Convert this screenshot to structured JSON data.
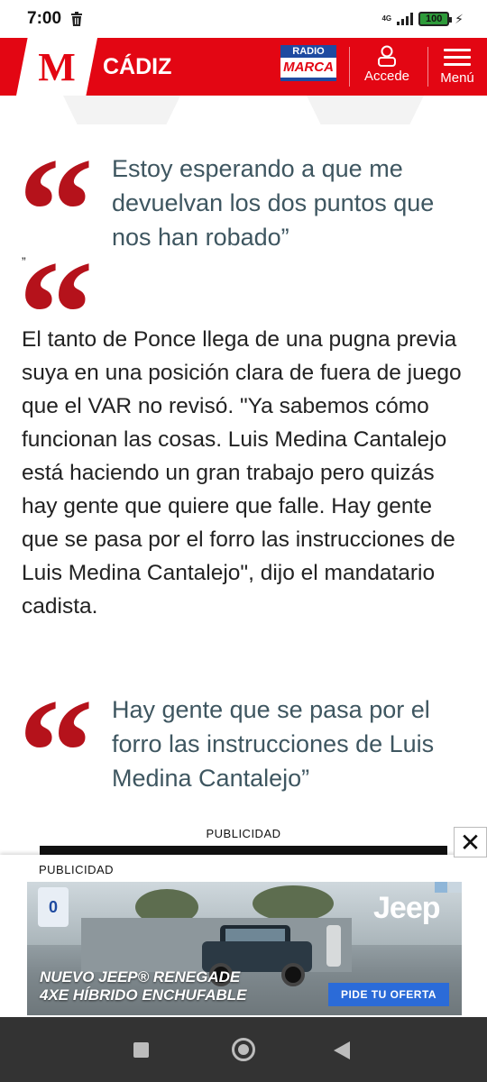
{
  "status_bar": {
    "time": "7:00",
    "network": "4G",
    "battery": "100"
  },
  "header": {
    "logo_letter": "M",
    "section": "CÁDIZ",
    "radio_top": "RADIO",
    "radio_bottom": "MARCA",
    "login_label": "Accede",
    "menu_label": "Menú",
    "brand_color": "#e30613"
  },
  "article": {
    "quote1": "Estoy esperando a que me devuelvan los dos puntos que nos han robado”",
    "stray_mark": "”",
    "paragraph": "El tanto de Ponce llega de una pugna previa suya en una posición clara de fuera de juego que el VAR no revisó. \"Ya sabemos cómo funcionan las cosas. Luis Medina Cantalejo está haciendo un gran trabajo pero quizás hay gente que quiere que falle. Hay gente que se pasa por el forro las instrucciones de Luis Medina Cantalejo\", dijo el mandatario cadista.",
    "quote2": "Hay gente que se pasa por el forro las instrucciones de Luis Medina Cantalejo”",
    "quote_glyph": "“"
  },
  "ads": {
    "inline_label": "PUBLICIDAD",
    "bottom_label": "PUBLICIDAD",
    "close_glyph": "✕",
    "brand": "Jeep",
    "headline_line1": "NUEVO JEEP® RENEGADE",
    "headline_line2": "4XE HÍBRIDO ENCHUFABLE",
    "cta": "PIDE TU OFERTA",
    "badge": "0"
  },
  "icons": [
    "trash-icon",
    "signal-icon",
    "battery-icon",
    "charging-bolt-icon",
    "user-icon",
    "hamburger-menu-icon",
    "close-icon",
    "nav-recents-icon",
    "nav-home-icon",
    "nav-back-icon"
  ]
}
